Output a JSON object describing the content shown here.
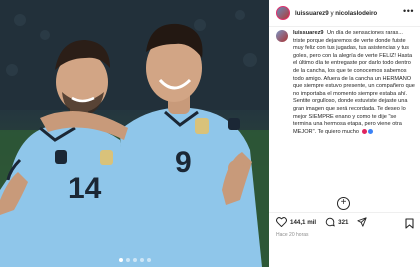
{
  "header": {
    "user1": "luissuarez9",
    "joiner": " y ",
    "user2": "nicolaslodeiro",
    "more_icon": "more-horizontal-icon"
  },
  "caption": {
    "username": "luissuarez9",
    "text": "Un día de sensaciones raras... triste porque dejaremos de verte donde fuiste muy feliz con tus jugadas, tus asistencias y tus goles, pero con la alegría de verte FELIZ! Hasta el último día te entregaste por darlo todo dentro de la cancha, los que te conocemos sabemos todo amigo. Afuera de la cancha un HERMANO que siempre estuvo presente, un compañero que no importaba el momento siempre estaba ahí. Sentite orgulloso, donde estuviste dejaste una gran imagen que será recordada. Te deseo lo mejor SIEMPRE enano y como te dije \"se termina una hermosa etapa, pero viene otra MEJOR\". Te quiero mucho",
    "emoji_colors": [
      "#e0245e",
      "#3b82f6"
    ]
  },
  "load_more_icon": "plus-circle-icon",
  "actions": {
    "likes": "144,1 mil",
    "comments": "321",
    "like_icon": "heart-icon",
    "comment_icon": "comment-icon",
    "share_icon": "send-icon",
    "save_icon": "bookmark-icon"
  },
  "timestamp": "Hace 20 horas",
  "photo": {
    "left_jersey_number": "14",
    "right_jersey_number": "9",
    "carousel_total": 5,
    "carousel_active": 1
  },
  "colors": {
    "uruguay_sky": "#8fc6ea",
    "text": "#262626",
    "muted": "#8e8e8e"
  }
}
